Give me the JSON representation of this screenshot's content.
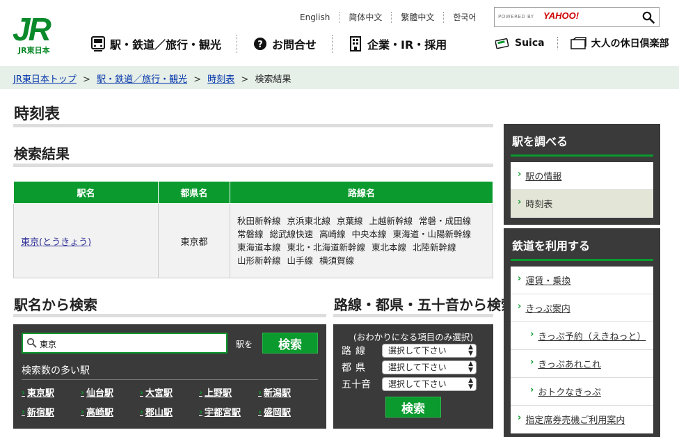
{
  "logo": {
    "mark": "JR",
    "sub": "JR東日本"
  },
  "lang_links": [
    "English",
    "简体中文",
    "繁體中文",
    "한국어"
  ],
  "top_search": {
    "powered": "POWERED BY",
    "brand": "YAHOO!"
  },
  "main_nav": [
    {
      "label": "駅・鉄道／旅行・観光",
      "icon": "train-icon"
    },
    {
      "label": "お問合せ",
      "icon": "question-icon"
    },
    {
      "label": "企業・IR・採用",
      "icon": "building-icon"
    }
  ],
  "util_nav": [
    {
      "label": "Suica",
      "icon": "suica-card-icon"
    },
    {
      "label": "大人の休日倶楽部",
      "icon": "card-holder-icon"
    }
  ],
  "breadcrumb": {
    "items": [
      "JR東日本トップ",
      "駅・鉄道／旅行・観光",
      "時刻表"
    ],
    "current": "検索結果",
    "sep": ">"
  },
  "page_title": "時刻表",
  "results_title": "検索結果",
  "results_table": {
    "headers": [
      "駅名",
      "都県名",
      "路線名"
    ],
    "rows": [
      {
        "station": "東京(とうきょう)",
        "prefecture": "東京都",
        "lines": [
          "秋田新幹線",
          "京浜東北線",
          "京葉線",
          "上越新幹線",
          "常磐・成田線",
          "常磐線",
          "総武線快速",
          "高崎線",
          "中央本線",
          "東海道・山陽新幹線",
          "東海道本線",
          "東北・北海道新幹線",
          "東北本線",
          "北陸新幹線",
          "山形新幹線",
          "山手線",
          "横須賀線"
        ]
      }
    ]
  },
  "station_search": {
    "title": "駅名から検索",
    "input_value": "東京",
    "suffix": "駅を",
    "button": "検索",
    "popular_title": "検索数の多い駅",
    "popular": [
      "東京駅",
      "仙台駅",
      "大宮駅",
      "上野駅",
      "新潟駅",
      "新宿駅",
      "高崎駅",
      "郡山駅",
      "宇都宮駅",
      "盛岡駅"
    ]
  },
  "route_search": {
    "title": "路線・都県・五十音から検索",
    "note": "(おわかりになる項目のみ選択)",
    "fields": [
      {
        "label": "路線",
        "value": "選択して下さい"
      },
      {
        "label": "都県",
        "value": "選択して下さい"
      },
      {
        "label": "五十音",
        "value": "選択して下さい"
      }
    ],
    "button": "検索"
  },
  "sidebar": {
    "station_box": {
      "title": "駅を調べる",
      "items": [
        {
          "label": "駅の情報",
          "active": false
        },
        {
          "label": "時刻表",
          "active": true
        }
      ]
    },
    "rail_box": {
      "title": "鉄道を利用する",
      "items": [
        {
          "label": "運賃・乗換",
          "sub": false
        },
        {
          "label": "きっぷ案内",
          "sub": false
        },
        {
          "label": "きっぷ予約（えきねっと）",
          "sub": true
        },
        {
          "label": "きっぷあれこれ",
          "sub": true
        },
        {
          "label": "おトクなきっぷ",
          "sub": true
        },
        {
          "label": "指定席券売機ご利用案内",
          "sub": false
        }
      ]
    }
  },
  "colors": {
    "brand_green": "#0a9a2e",
    "dark_panel": "#3a3a3a",
    "breadcrumb_bg": "#e6efe8"
  }
}
